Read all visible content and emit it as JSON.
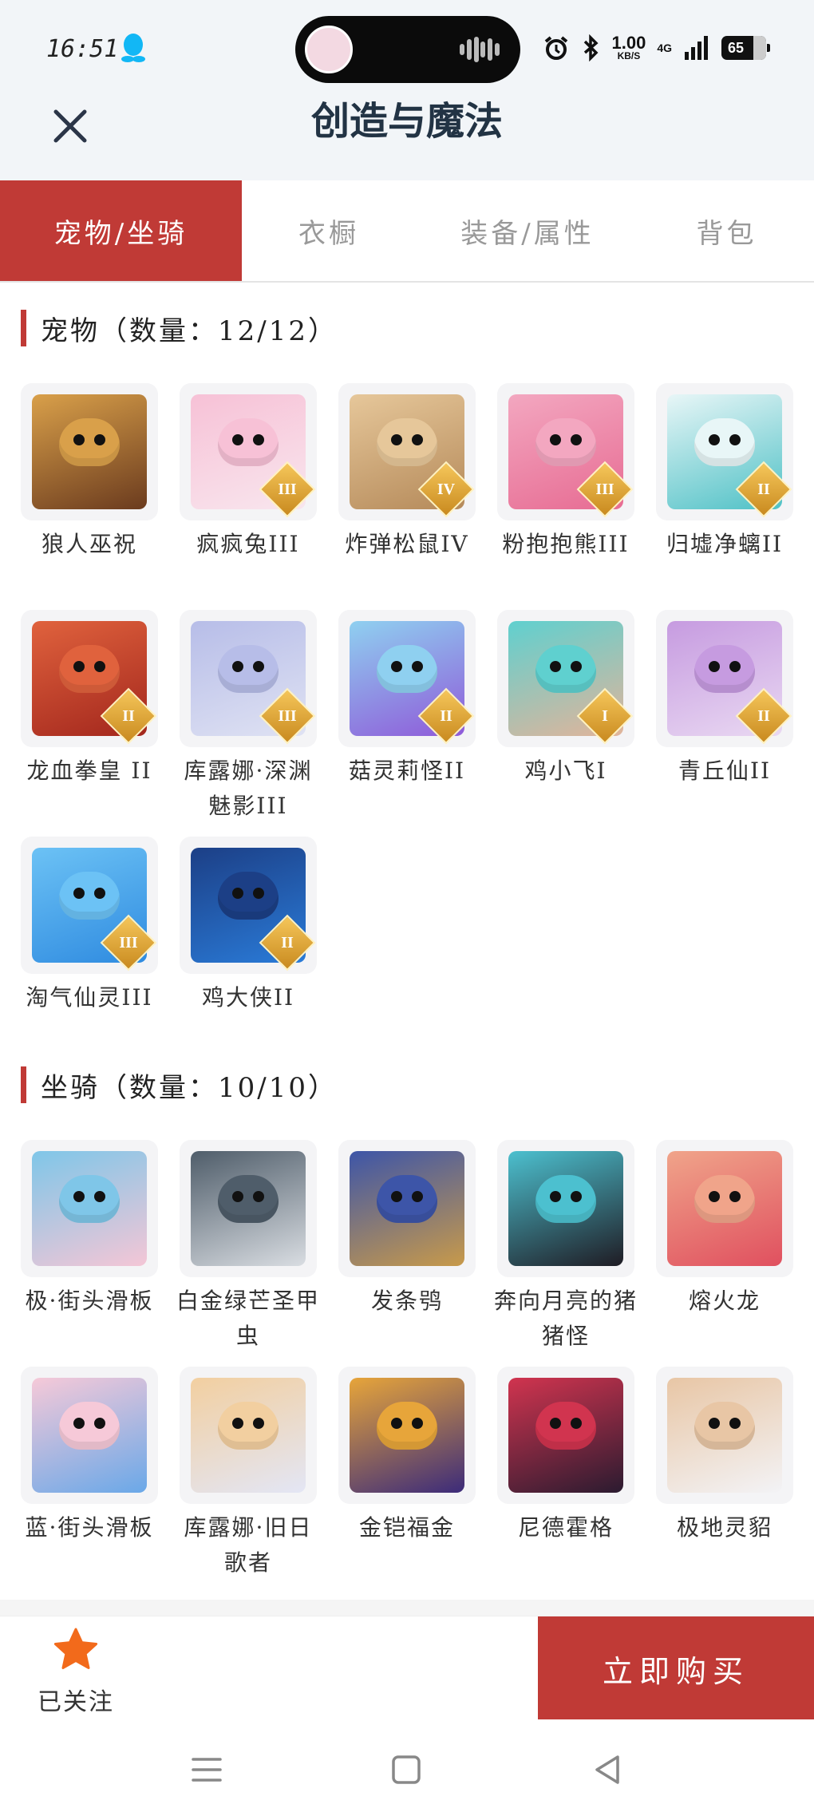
{
  "status_bar": {
    "time": "16:51",
    "net_speed": "1.00",
    "net_unit": "KB/S",
    "network": "4G",
    "battery": "65"
  },
  "header": {
    "title": "创造与魔法"
  },
  "tabs": [
    {
      "label": "宠物/坐骑"
    },
    {
      "label": "衣橱"
    },
    {
      "label": "装备/属性"
    },
    {
      "label": "背包"
    }
  ],
  "pets_section": {
    "title": "宠物（数量：12/12）",
    "items": [
      {
        "name": "狼人巫祝",
        "rank": "",
        "c1": "#6b3b1e",
        "c2": "#d9a04a"
      },
      {
        "name": "疯疯兔III",
        "rank": "III",
        "c1": "#f8e6ee",
        "c2": "#f7c1d6"
      },
      {
        "name": "炸弹松鼠IV",
        "rank": "IV",
        "c1": "#b58a5a",
        "c2": "#e6c79a"
      },
      {
        "name": "粉抱抱熊III",
        "rank": "III",
        "c1": "#e76c93",
        "c2": "#f3a7c0"
      },
      {
        "name": "归墟净螭II",
        "rank": "II",
        "c1": "#4fc1c6",
        "c2": "#e8f6f7"
      },
      {
        "name": "龙血拳皇 II",
        "rank": "II",
        "c1": "#a3271d",
        "c2": "#e0623d"
      },
      {
        "name": "库露娜·深渊魅影III",
        "rank": "III",
        "c1": "#dfe2f3",
        "c2": "#b7bde8"
      },
      {
        "name": "菇灵莉怪II",
        "rank": "II",
        "c1": "#8f5ad9",
        "c2": "#8fd0f0"
      },
      {
        "name": "鸡小飞I",
        "rank": "I",
        "c1": "#e2b49a",
        "c2": "#5fd0cf"
      },
      {
        "name": "青丘仙II",
        "rank": "II",
        "c1": "#e9d8f2",
        "c2": "#c69be0"
      },
      {
        "name": "淘气仙灵III",
        "rank": "III",
        "c1": "#2f8be0",
        "c2": "#6cc2f5"
      },
      {
        "name": "鸡大侠II",
        "rank": "II",
        "c1": "#2a7bd8",
        "c2": "#1c3f86"
      }
    ]
  },
  "mounts_section": {
    "title": "坐骑（数量：10/10）",
    "items": [
      {
        "name": "极·街头滑板",
        "rank": "",
        "c1": "#f4c6d6",
        "c2": "#7fc6e8"
      },
      {
        "name": "白金绿芒圣甲虫",
        "rank": "",
        "c1": "#d9dde2",
        "c2": "#4f5d6a"
      },
      {
        "name": "发条鸮",
        "rank": "",
        "c1": "#c89a4a",
        "c2": "#3d55a8"
      },
      {
        "name": "奔向月亮的猪猪怪",
        "rank": "",
        "c1": "#1f1c24",
        "c2": "#4cc0cf"
      },
      {
        "name": "熔火龙",
        "rank": "",
        "c1": "#e0505f",
        "c2": "#f0a48a"
      },
      {
        "name": "蓝·街头滑板",
        "rank": "",
        "c1": "#6aa8e8",
        "c2": "#f6c9d8"
      },
      {
        "name": "库露娜·旧日歌者",
        "rank": "",
        "c1": "#e3e6f5",
        "c2": "#f2cfa0"
      },
      {
        "name": "金铠福金",
        "rank": "",
        "c1": "#3c2b7a",
        "c2": "#e7a53a"
      },
      {
        "name": "尼德霍格",
        "rank": "",
        "c1": "#2b1b30",
        "c2": "#d1344f"
      },
      {
        "name": "极地灵貂",
        "rank": "",
        "c1": "#f3f3f6",
        "c2": "#e8c6a5"
      }
    ]
  },
  "bottom_bar": {
    "follow_label": "已关注",
    "buy_label": "立即购买",
    "accent": "#c03a36"
  }
}
